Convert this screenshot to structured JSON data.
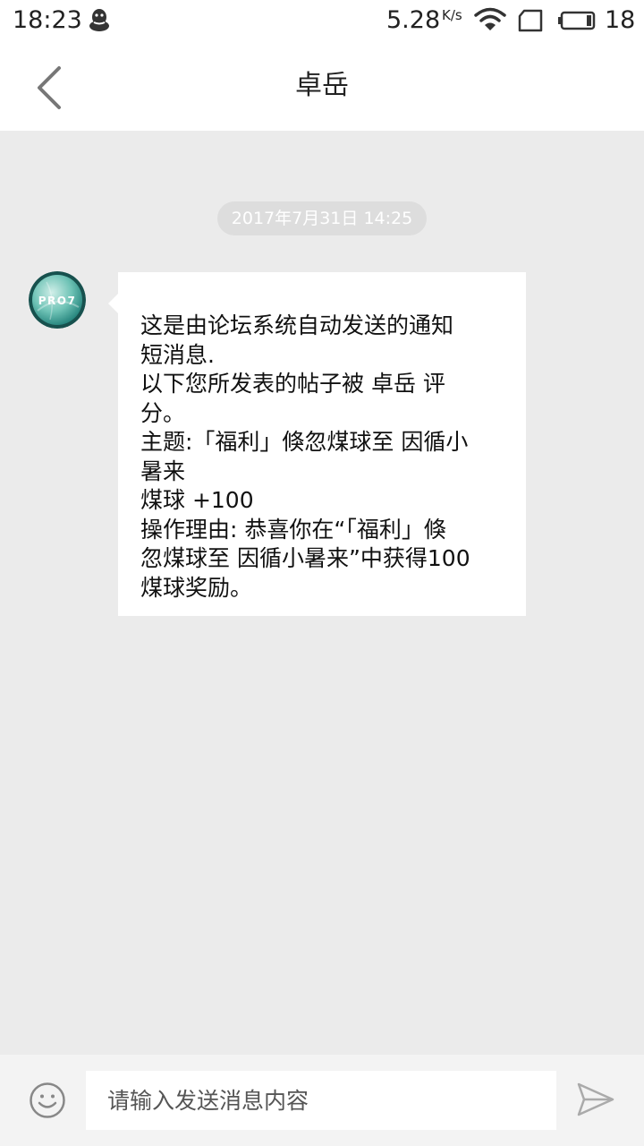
{
  "status_bar": {
    "time": "18:23",
    "network_speed": "5.28",
    "network_speed_unit": "K/s",
    "battery_level": "18"
  },
  "header": {
    "title": "卓岳"
  },
  "conversation": {
    "timestamp": "2017年7月31日 14:25",
    "avatar_text": "PRO7",
    "message_lines": [
      "这是由论坛系统自动发送的通知",
      "短消息.",
      "以下您所发表的帖子被 卓岳 评",
      "分。",
      "主题:「福利」倏忽煤球至 因循小",
      "暑来",
      "煤球 +100",
      "操作理由: 恭喜你在“「福利」倏",
      "忽煤球至 因循小暑来”中获得100",
      "煤球奖励。"
    ]
  },
  "input_bar": {
    "placeholder": "请输入发送消息内容",
    "value": ""
  },
  "icons": {
    "back": "chevron-left-icon",
    "emoji": "smiley-icon",
    "send": "send-arrow-icon"
  },
  "colors": {
    "background": "#ebebeb",
    "bubble": "#ffffff",
    "timestamp_pill": "#dddddd"
  }
}
